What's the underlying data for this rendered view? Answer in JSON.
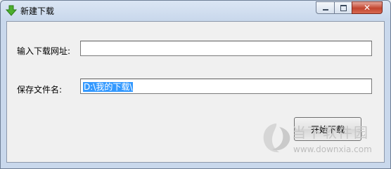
{
  "window": {
    "title": "新建下载"
  },
  "caption": {
    "close_glyph": "✕"
  },
  "form": {
    "url_label": "输入下载网址:",
    "url_value": "",
    "filename_label": "保存文件名:",
    "filename_value": "D:\\我的下载\\"
  },
  "actions": {
    "start_label": "开始下载"
  },
  "watermark": {
    "brand": "当下软件园",
    "url": "www.downxia.com"
  },
  "colors": {
    "selection": "#3399ff",
    "close_button": "#c2452f"
  }
}
